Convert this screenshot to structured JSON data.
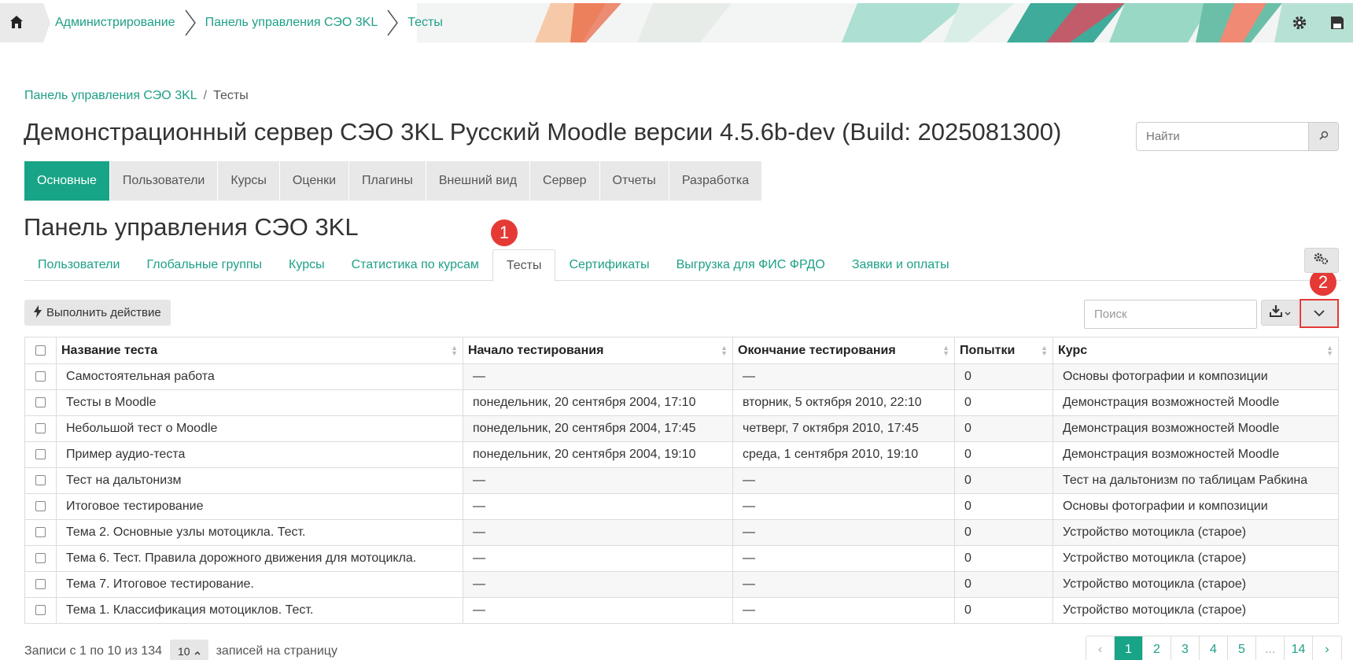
{
  "header": {
    "crumbs": [
      "Администрирование",
      "Панель управления СЭО 3KL",
      "Тесты"
    ]
  },
  "breadcrumb": {
    "link": "Панель управления СЭО 3KL",
    "separator": "/",
    "current": "Тесты"
  },
  "page_title": "Демонстрационный сервер СЭО 3KL Русский Moodle версии 4.5.6b-dev (Build: 2025081300)",
  "search": {
    "placeholder": "Найти"
  },
  "main_tabs": [
    "Основные",
    "Пользователи",
    "Курсы",
    "Оценки",
    "Плагины",
    "Внешний вид",
    "Сервер",
    "Отчеты",
    "Разработка"
  ],
  "section_title": "Панель управления СЭО 3KL",
  "sub_tabs": [
    "Пользователи",
    "Глобальные группы",
    "Курсы",
    "Статистика по курсам",
    "Тесты",
    "Сертификаты",
    "Выгрузка для ФИС ФРДО",
    "Заявки и оплаты"
  ],
  "badges": {
    "one": "1",
    "two": "2"
  },
  "toolbar": {
    "action_label": "Выполнить действие",
    "search_placeholder": "Поиск"
  },
  "table": {
    "headers": [
      "Название теста",
      "Начало тестирования",
      "Окончание тестирования",
      "Попытки",
      "Курс"
    ],
    "rows": [
      [
        "Самостоятельная работа",
        "—",
        "—",
        "0",
        "Основы фотографии и композиции"
      ],
      [
        "Тесты в Moodle",
        "понедельник, 20 сентября 2004, 17:10",
        "вторник, 5 октября 2010, 22:10",
        "0",
        "Демонстрация возможностей Moodle"
      ],
      [
        "Небольшой тест о Moodle",
        "понедельник, 20 сентября 2004, 17:45",
        "четверг, 7 октября 2010, 17:45",
        "0",
        "Демонстрация возможностей Moodle"
      ],
      [
        "Пример аудио-теста",
        "понедельник, 20 сентября 2004, 19:10",
        "среда, 1 сентября 2010, 19:10",
        "0",
        "Демонстрация возможностей Moodle"
      ],
      [
        "Тест на дальтонизм",
        "—",
        "—",
        "0",
        "Тест на дальтонизм по таблицам Рабкина"
      ],
      [
        "Итоговое тестирование",
        "—",
        "—",
        "0",
        "Основы фотографии и композиции"
      ],
      [
        "Тема 2. Основные узлы мотоцикла. Тест.",
        "—",
        "—",
        "0",
        "Устройство мотоцикла (старое)"
      ],
      [
        "Тема 6. Тест. Правила дорожного движения для мотоцикла.",
        "—",
        "—",
        "0",
        "Устройство мотоцикла (старое)"
      ],
      [
        "Тема 7. Итоговое тестирование.",
        "—",
        "—",
        "0",
        "Устройство мотоцикла (старое)"
      ],
      [
        "Тема 1. Классификация мотоциклов. Тест.",
        "—",
        "—",
        "0",
        "Устройство мотоцикла (старое)"
      ]
    ]
  },
  "footer": {
    "records_text": "Записи с 1 по 10 из 134",
    "per_page_value": "10",
    "per_page_label": "записей на страницу",
    "pages": [
      "‹",
      "1",
      "2",
      "3",
      "4",
      "5",
      "...",
      "14",
      "›"
    ]
  },
  "colors": {
    "accent": "#18a486",
    "link": "#1ea087",
    "badge": "#e53935"
  }
}
